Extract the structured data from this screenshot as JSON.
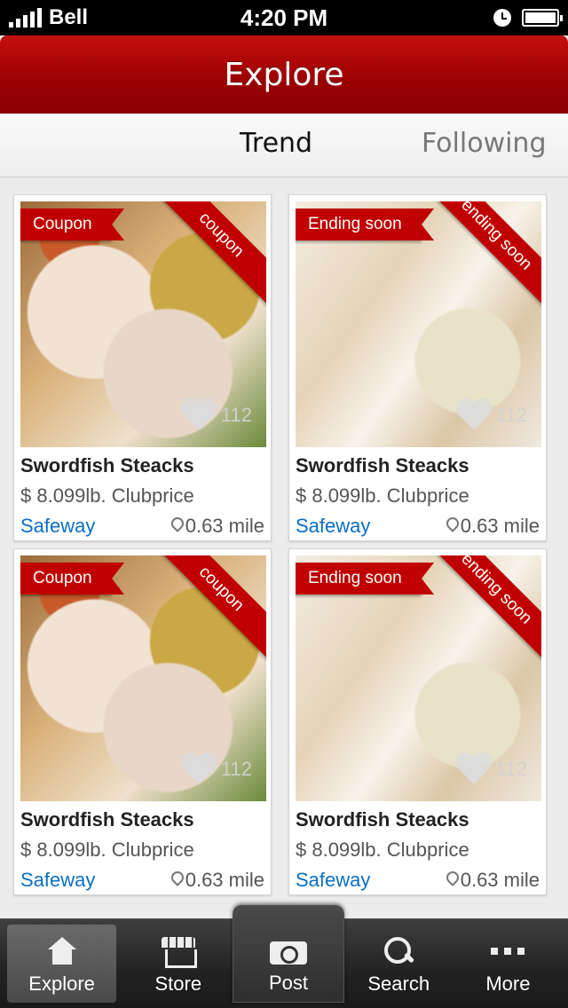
{
  "status_bar": {
    "carrier": "Bell",
    "time": "4:20 PM"
  },
  "header": {
    "title": "Explore"
  },
  "tabs": [
    {
      "label": "Trend",
      "active": true
    },
    {
      "label": "Following",
      "active": false
    }
  ],
  "cards": [
    {
      "badge": "Coupon",
      "corner": "coupon",
      "title": "Swordfish Steacks",
      "price": "$ 8.099lb. Clubprice",
      "store": "Safeway",
      "distance": "0.63 mile",
      "likes": "112",
      "image": "roast-chicken-couscous"
    },
    {
      "badge": "Ending soon",
      "corner": "ending soon",
      "title": "Swordfish Steacks",
      "price": "$ 8.099lb. Clubprice",
      "store": "Safeway",
      "distance": "0.63 mile",
      "likes": "112",
      "image": "breakfast-burrito"
    },
    {
      "badge": "Coupon",
      "corner": "coupon",
      "title": "Swordfish Steacks",
      "price": "$ 8.099lb. Clubprice",
      "store": "Safeway",
      "distance": "0.63 mile",
      "likes": "112",
      "image": "roast-chicken-couscous"
    },
    {
      "badge": "Ending soon",
      "corner": "ending soon",
      "title": "Swordfish Steacks",
      "price": "$ 8.099lb. Clubprice",
      "store": "Safeway",
      "distance": "0.63 mile",
      "likes": "112",
      "image": "breakfast-burrito"
    }
  ],
  "tabbar": [
    {
      "label": "Explore",
      "icon": "home-icon",
      "selected": true
    },
    {
      "label": "Store",
      "icon": "store-icon",
      "selected": false
    },
    {
      "label": "Post",
      "icon": "camera-icon",
      "selected": false
    },
    {
      "label": "Search",
      "icon": "search-icon",
      "selected": false
    },
    {
      "label": "More",
      "icon": "more-icon",
      "selected": false
    }
  ],
  "colors": {
    "brand_red": "#c00000",
    "link_blue": "#0a6fc4"
  }
}
